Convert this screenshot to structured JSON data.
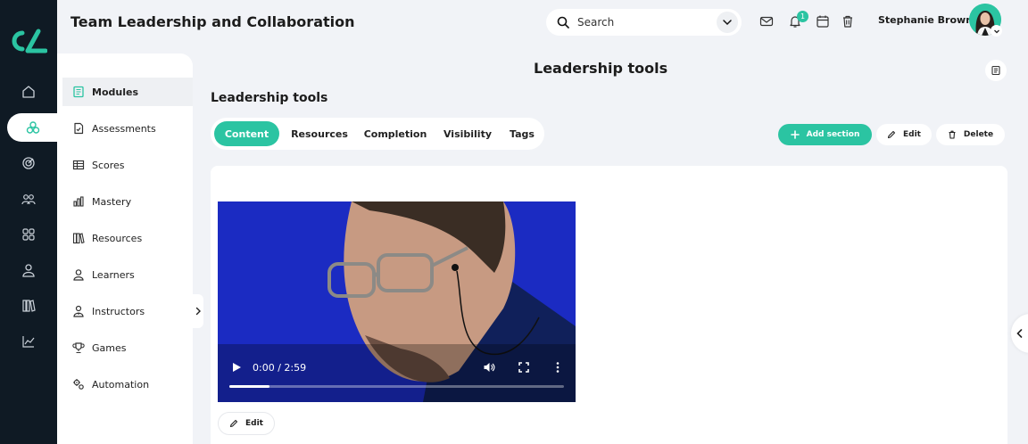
{
  "header": {
    "app_title": "Team Leadership and Collaboration",
    "search_placeholder": "Search",
    "notification_count": "1",
    "user_name": "Stephanie Brown"
  },
  "rail": {
    "items": [
      {
        "icon": "home-icon"
      },
      {
        "icon": "modules-icon",
        "active": true
      },
      {
        "icon": "target-icon"
      },
      {
        "icon": "groups-icon"
      },
      {
        "icon": "grid-icon"
      },
      {
        "icon": "user-icon"
      },
      {
        "icon": "library-icon"
      },
      {
        "icon": "analytics-icon"
      }
    ]
  },
  "sidebar": {
    "items": [
      {
        "label": "Modules",
        "icon": "modules-book-icon",
        "active": true
      },
      {
        "label": "Assessments",
        "icon": "assessment-icon"
      },
      {
        "label": "Scores",
        "icon": "table-icon"
      },
      {
        "label": "Mastery",
        "icon": "bar-chart-icon"
      },
      {
        "label": "Resources",
        "icon": "books-icon"
      },
      {
        "label": "Learners",
        "icon": "learner-icon"
      },
      {
        "label": "Instructors",
        "icon": "instructor-icon"
      },
      {
        "label": "Games",
        "icon": "trophy-icon"
      },
      {
        "label": "Automation",
        "icon": "gears-icon"
      }
    ]
  },
  "main": {
    "page_title": "Leadership tools",
    "section_title": "Leadership tools",
    "tabs": [
      {
        "label": "Content",
        "active": true
      },
      {
        "label": "Resources"
      },
      {
        "label": "Completion"
      },
      {
        "label": "Visibility"
      },
      {
        "label": "Tags"
      }
    ],
    "actions": {
      "add_section": "Add section",
      "edit": "Edit",
      "delete": "Delete"
    },
    "video": {
      "time": "0:00 / 2:59",
      "progress": 0.12
    },
    "edit_video": "Edit"
  },
  "colors": {
    "accent": "#2bc4a2",
    "rail": "#0f1a24",
    "background": "#f1f3f7"
  }
}
